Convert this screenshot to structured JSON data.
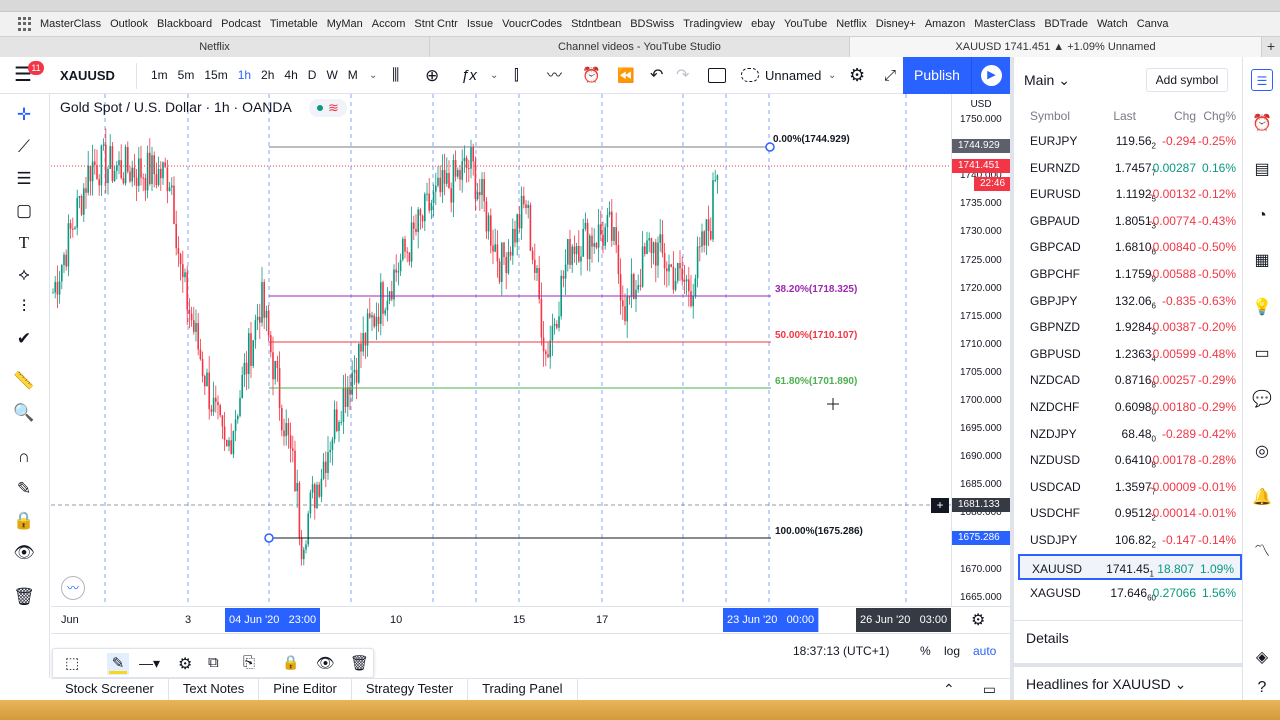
{
  "bookmarks": [
    "MasterClass",
    "Outlook",
    "Blackboard",
    "Podcast",
    "Timetable",
    "MyMan",
    "Accom",
    "Stnt Cntr",
    "Issue",
    "VoucrCodes",
    "Stdntbean",
    "BDSwiss",
    "Tradingview",
    "ebay",
    "YouTube",
    "Netflix",
    "Disney+",
    "Amazon",
    "MasterClass",
    "BDTrade",
    "Watch",
    "Canva"
  ],
  "tabs": [
    "Netflix",
    "Channel videos - YouTube Studio",
    "XAUUSD 1741.451 ▲ +1.09% Unnamed"
  ],
  "topbar": {
    "badge": "11",
    "symbol": "XAUUSD",
    "intervals": [
      "1m",
      "5m",
      "15m",
      "1h",
      "2h",
      "4h",
      "D",
      "W",
      "M"
    ],
    "active_interval": "1h",
    "layout_name": "Unnamed",
    "publish_label": "Publish"
  },
  "legend": {
    "title": "Gold Spot / U.S. Dollar · 1h · OANDA"
  },
  "fib": [
    {
      "label": "0.00%(1744.929)",
      "color": "#131722"
    },
    {
      "label": "38.20%(1718.325)",
      "color": "#9c27b0"
    },
    {
      "label": "50.00%(1710.107)",
      "color": "#f23645"
    },
    {
      "label": "61.80%(1701.890)",
      "color": "#4caf50"
    },
    {
      "label": "100.00%(1675.286)",
      "color": "#131722"
    }
  ],
  "price_axis": {
    "currency": "USD",
    "ticks": [
      "1750.000",
      "1745.000",
      "1740.000",
      "1735.000",
      "1730.000",
      "1725.000",
      "1720.000",
      "1715.000",
      "1710.000",
      "1705.000",
      "1700.000",
      "1695.000",
      "1690.000",
      "1685.000",
      "1680.000",
      "1675.000",
      "1670.000",
      "1665.000"
    ],
    "tag_high": "1744.929",
    "tag_last": "1741.451",
    "tag_countdown": "22:46",
    "tag_cross": "1681.133",
    "tag_low": "1675.286"
  },
  "time_axis": {
    "labels": [
      "Jun",
      "3",
      "10",
      "15",
      "17"
    ],
    "sel_start": "04 Jun '20   23:00",
    "sel_end": "23 Jun '20   00:00",
    "cursor_time": "26 Jun '20   03:00"
  },
  "status": {
    "clock": "18:37:13 (UTC+1)",
    "pct": "%",
    "log": "log",
    "auto": "auto"
  },
  "bottom_tabs": [
    "Stock Screener",
    "Text Notes",
    "Pine Editor",
    "Strategy Tester",
    "Trading Panel"
  ],
  "watchlist": {
    "title": "Main",
    "add_label": "Add symbol",
    "columns": [
      "Symbol",
      "Last",
      "Chg",
      "Chg%"
    ],
    "rows": [
      {
        "symbol": "EURJPY",
        "last": "119.56",
        "last_sub": "2",
        "chg": "-0.294",
        "pct": "-0.25%",
        "dir": "neg"
      },
      {
        "symbol": "EURNZD",
        "last": "1.7457",
        "last_sub": "7",
        "chg": "0.00287",
        "pct": "0.16%",
        "dir": "pos"
      },
      {
        "symbol": "EURUSD",
        "last": "1.1192",
        "last_sub": "5",
        "chg": "-0.00132",
        "pct": "-0.12%",
        "dir": "neg"
      },
      {
        "symbol": "GBPAUD",
        "last": "1.8051",
        "last_sub": "3",
        "chg": "-0.00774",
        "pct": "-0.43%",
        "dir": "neg"
      },
      {
        "symbol": "GBPCAD",
        "last": "1.6810",
        "last_sub": "6",
        "chg": "-0.00840",
        "pct": "-0.50%",
        "dir": "neg"
      },
      {
        "symbol": "GBPCHF",
        "last": "1.1759",
        "last_sub": "9",
        "chg": "-0.00588",
        "pct": "-0.50%",
        "dir": "neg"
      },
      {
        "symbol": "GBPJPY",
        "last": "132.06",
        "last_sub": "6",
        "chg": "-0.835",
        "pct": "-0.63%",
        "dir": "neg"
      },
      {
        "symbol": "GBPNZD",
        "last": "1.9284",
        "last_sub": "3",
        "chg": "-0.00387",
        "pct": "-0.20%",
        "dir": "neg"
      },
      {
        "symbol": "GBPUSD",
        "last": "1.2363",
        "last_sub": "4",
        "chg": "-0.00599",
        "pct": "-0.48%",
        "dir": "neg"
      },
      {
        "symbol": "NZDCAD",
        "last": "0.8716",
        "last_sub": "8",
        "chg": "-0.00257",
        "pct": "-0.29%",
        "dir": "neg"
      },
      {
        "symbol": "NZDCHF",
        "last": "0.6098",
        "last_sub": "0",
        "chg": "-0.00180",
        "pct": "-0.29%",
        "dir": "neg"
      },
      {
        "symbol": "NZDJPY",
        "last": "68.48",
        "last_sub": "0",
        "chg": "-0.289",
        "pct": "-0.42%",
        "dir": "neg"
      },
      {
        "symbol": "NZDUSD",
        "last": "0.6410",
        "last_sub": "8",
        "chg": "-0.00178",
        "pct": "-0.28%",
        "dir": "neg"
      },
      {
        "symbol": "USDCAD",
        "last": "1.3597",
        "last_sub": "7",
        "chg": "-0.00009",
        "pct": "-0.01%",
        "dir": "neg"
      },
      {
        "symbol": "USDCHF",
        "last": "0.9512",
        "last_sub": "2",
        "chg": "-0.00014",
        "pct": "-0.01%",
        "dir": "neg"
      },
      {
        "symbol": "USDJPY",
        "last": "106.82",
        "last_sub": "2",
        "chg": "-0.147",
        "pct": "-0.14%",
        "dir": "neg"
      },
      {
        "symbol": "XAUUSD",
        "last": "1741.45",
        "last_sub": "1",
        "chg": "18.807",
        "pct": "1.09%",
        "dir": "pos",
        "selected": true
      },
      {
        "symbol": "XAGUSD",
        "last": "17.646",
        "last_sub": "60",
        "chg": "0.27066",
        "pct": "1.56%",
        "dir": "pos"
      }
    ],
    "details_label": "Details",
    "headlines_label": "Headlines for XAUUSD"
  }
}
